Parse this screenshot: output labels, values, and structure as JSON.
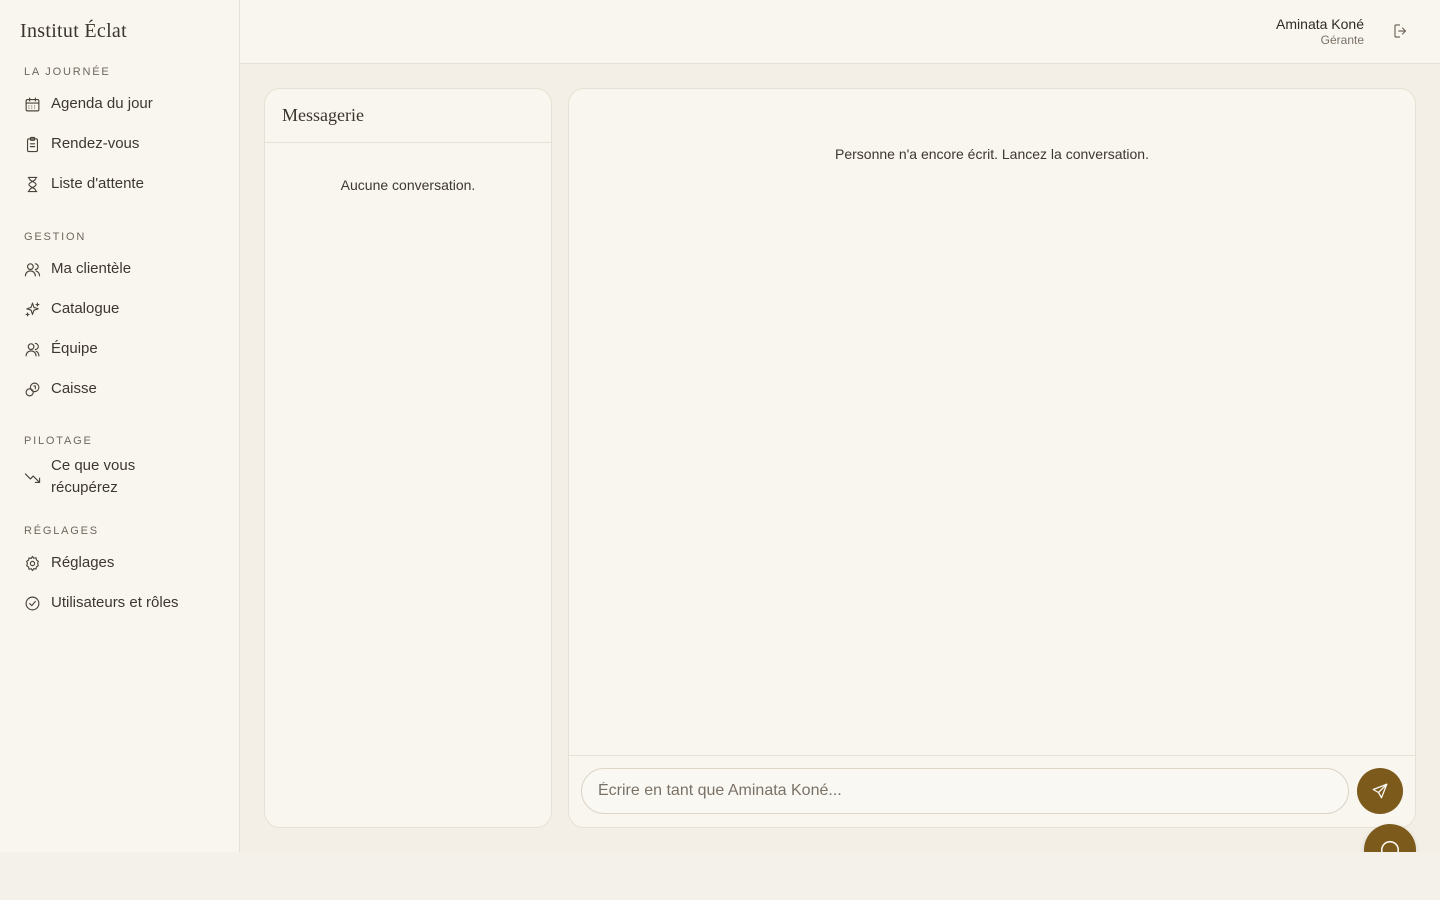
{
  "brand": {
    "name": "Institut Éclat"
  },
  "sidebar": {
    "sections": [
      {
        "heading": "LA JOURNÉE",
        "items": [
          {
            "label": "Agenda du jour",
            "icon": "calendar-icon"
          },
          {
            "label": "Rendez-vous",
            "icon": "clipboard-icon"
          },
          {
            "label": "Liste d'attente",
            "icon": "hourglass-icon"
          }
        ]
      },
      {
        "heading": "GESTION",
        "items": [
          {
            "label": "Ma clientèle",
            "icon": "users-icon"
          },
          {
            "label": "Catalogue",
            "icon": "sparkles-icon"
          },
          {
            "label": "Équipe",
            "icon": "team-icon"
          },
          {
            "label": "Caisse",
            "icon": "coins-icon"
          }
        ]
      },
      {
        "heading": "PILOTAGE",
        "items": [
          {
            "label": "Ce que vous récupérez",
            "icon": "trend-down-icon"
          }
        ]
      },
      {
        "heading": "RÉGLAGES",
        "items": [
          {
            "label": "Réglages",
            "icon": "gear-icon"
          },
          {
            "label": "Utilisateurs et rôles",
            "icon": "check-circle-icon"
          }
        ]
      }
    ]
  },
  "header": {
    "user_name": "Aminata Koné",
    "user_role": "Gérante",
    "logout_icon": "logout-icon"
  },
  "conversations": {
    "title": "Messagerie",
    "empty_text": "Aucune conversation."
  },
  "chat": {
    "empty_text": "Personne n'a encore écrit. Lancez la conversation.",
    "input_placeholder": "Écrire en tant que Aminata Koné...",
    "input_value": "",
    "send_icon": "send-icon"
  },
  "fab": {
    "icon": "chat-bubble-icon"
  },
  "colors": {
    "accent": "#7b5a1c",
    "background": "#f4efe6",
    "surface": "#f9f6f0",
    "border": "#e7e0d4"
  }
}
